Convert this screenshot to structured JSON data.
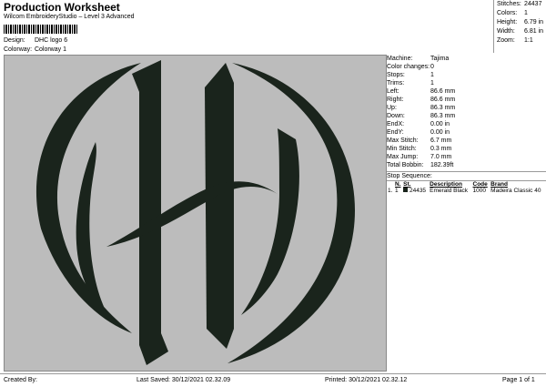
{
  "header": {
    "title": "Production Worksheet",
    "subtitle": "Wilcom EmbroideryStudio – Level 3 Advanced",
    "design_label": "Design:",
    "design_value": "DHC logo 6",
    "colorway_label": "Colorway:",
    "colorway_value": "Colorway 1"
  },
  "stats": [
    {
      "label": "Stitches:",
      "value": "24437"
    },
    {
      "label": "Colors:",
      "value": "1"
    },
    {
      "label": "Height:",
      "value": "6.79 in"
    },
    {
      "label": "Width:",
      "value": "6.81 in"
    },
    {
      "label": "Zoom:",
      "value": "1:1"
    }
  ],
  "details": [
    {
      "label": "Machine:",
      "value": "Tajima"
    },
    {
      "label": "Color changes:",
      "value": "0"
    },
    {
      "label": "Stops:",
      "value": "1"
    },
    {
      "label": "Trims:",
      "value": "1"
    },
    {
      "label": "Left:",
      "value": "86.6 mm"
    },
    {
      "label": "Right:",
      "value": "86.6 mm"
    },
    {
      "label": "Up:",
      "value": "86.3 mm"
    },
    {
      "label": "Down:",
      "value": "86.3 mm"
    },
    {
      "label": "EndX:",
      "value": "0.00 in"
    },
    {
      "label": "EndY:",
      "value": "0.00 in"
    },
    {
      "label": "Max Stitch:",
      "value": "6.7 mm"
    },
    {
      "label": "Min Stitch:",
      "value": "0.3 mm"
    },
    {
      "label": "Max Jump:",
      "value": "7.0 mm"
    },
    {
      "label": "Total Bobbin:",
      "value": "182.39ft"
    }
  ],
  "stop_sequence": {
    "title": "Stop Sequence:",
    "headers": [
      "#",
      "N.",
      "St.",
      "Description",
      "Code",
      "Brand"
    ],
    "rows": [
      {
        "num": "1.",
        "n": "1",
        "st": "24435",
        "description": "Emerald Black",
        "code": "1000",
        "brand": "Madeira Classic 40",
        "color": "#1a241c"
      }
    ]
  },
  "footer": {
    "created_by": "Created By:",
    "last_saved": "Last Saved: 30/12/2021 02.32.09",
    "printed": "Printed: 30/12/2021 02.32.12",
    "page": "Page 1 of 1"
  },
  "design_color": "#1a241c",
  "background_color": "#bcbcbc"
}
